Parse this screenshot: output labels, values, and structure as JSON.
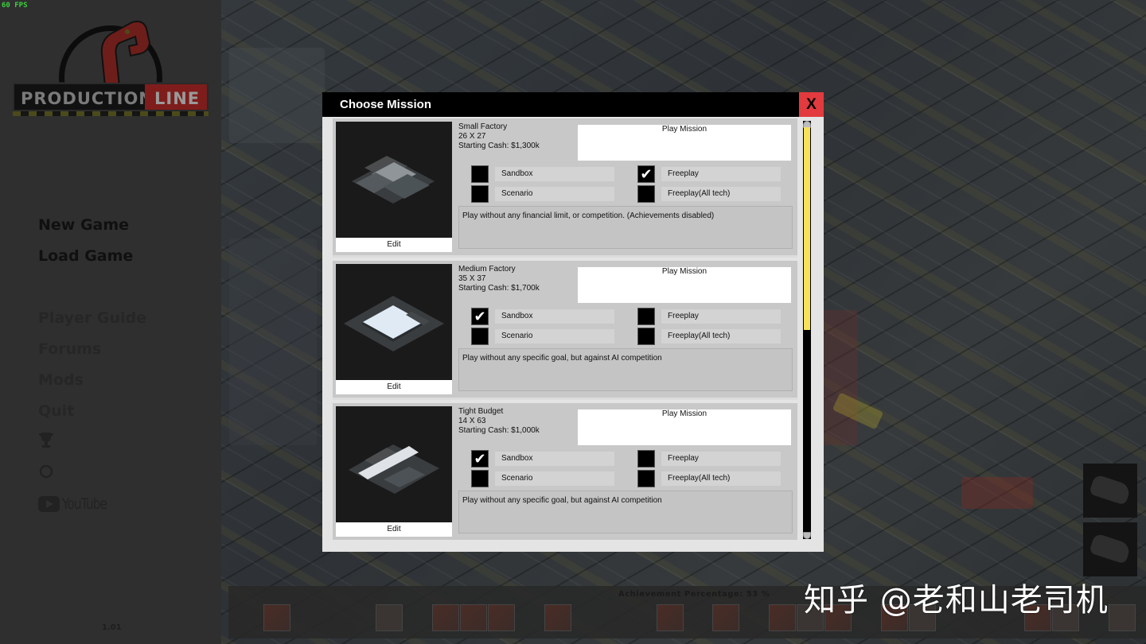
{
  "hud": {
    "fps": "60 FPS"
  },
  "logo": {
    "word1": "PRODUCTION",
    "word2": "LINE"
  },
  "menu": {
    "primary": [
      "New Game",
      "Load Game"
    ],
    "secondary": [
      "Player Guide",
      "Forums",
      "Mods",
      "Quit"
    ],
    "icons": [
      "trophy-icon",
      "circle-icon",
      "youtube-icon"
    ],
    "youtube_label": "YouTube"
  },
  "version": "1.01",
  "achievements": {
    "label": "Achievement Percentage: 53 %"
  },
  "watermark": "知乎 @老和山老司机",
  "dialog": {
    "title": "Choose Mission",
    "close_label": "X",
    "scroll_position": 0.0,
    "scroll_visible_fraction": 0.5,
    "missions": [
      {
        "name": "Small Factory",
        "size": "26 X 27",
        "cash": "Starting Cash: $1,300k",
        "edit_label": "Edit",
        "play_label": "Play Mission",
        "options": [
          {
            "label": "Sandbox",
            "checked": false
          },
          {
            "label": "Freeplay",
            "checked": true
          },
          {
            "label": "Scenario",
            "checked": false
          },
          {
            "label": "Freeplay(All tech)",
            "checked": false
          }
        ],
        "description": "Play without any financial limit, or competition. (Achievements disabled)"
      },
      {
        "name": "Medium Factory",
        "size": "35 X 37",
        "cash": "Starting Cash: $1,700k",
        "edit_label": "Edit",
        "play_label": "Play Mission",
        "options": [
          {
            "label": "Sandbox",
            "checked": true
          },
          {
            "label": "Freeplay",
            "checked": false
          },
          {
            "label": "Scenario",
            "checked": false
          },
          {
            "label": "Freeplay(All tech)",
            "checked": false
          }
        ],
        "description": "Play without any specific goal, but against AI competition"
      },
      {
        "name": "Tight Budget",
        "size": "14 X 63",
        "cash": "Starting Cash: $1,000k",
        "edit_label": "Edit",
        "play_label": "Play Mission",
        "options": [
          {
            "label": "Sandbox",
            "checked": true
          },
          {
            "label": "Freeplay",
            "checked": false
          },
          {
            "label": "Scenario",
            "checked": false
          },
          {
            "label": "Freeplay(All tech)",
            "checked": false
          }
        ],
        "description": "Play without any specific goal, but against AI competition"
      }
    ]
  },
  "colors": {
    "accent_close": "#e23a3e",
    "scroll_thumb": "#f6e15a",
    "fps_green": "#3bd13b"
  }
}
